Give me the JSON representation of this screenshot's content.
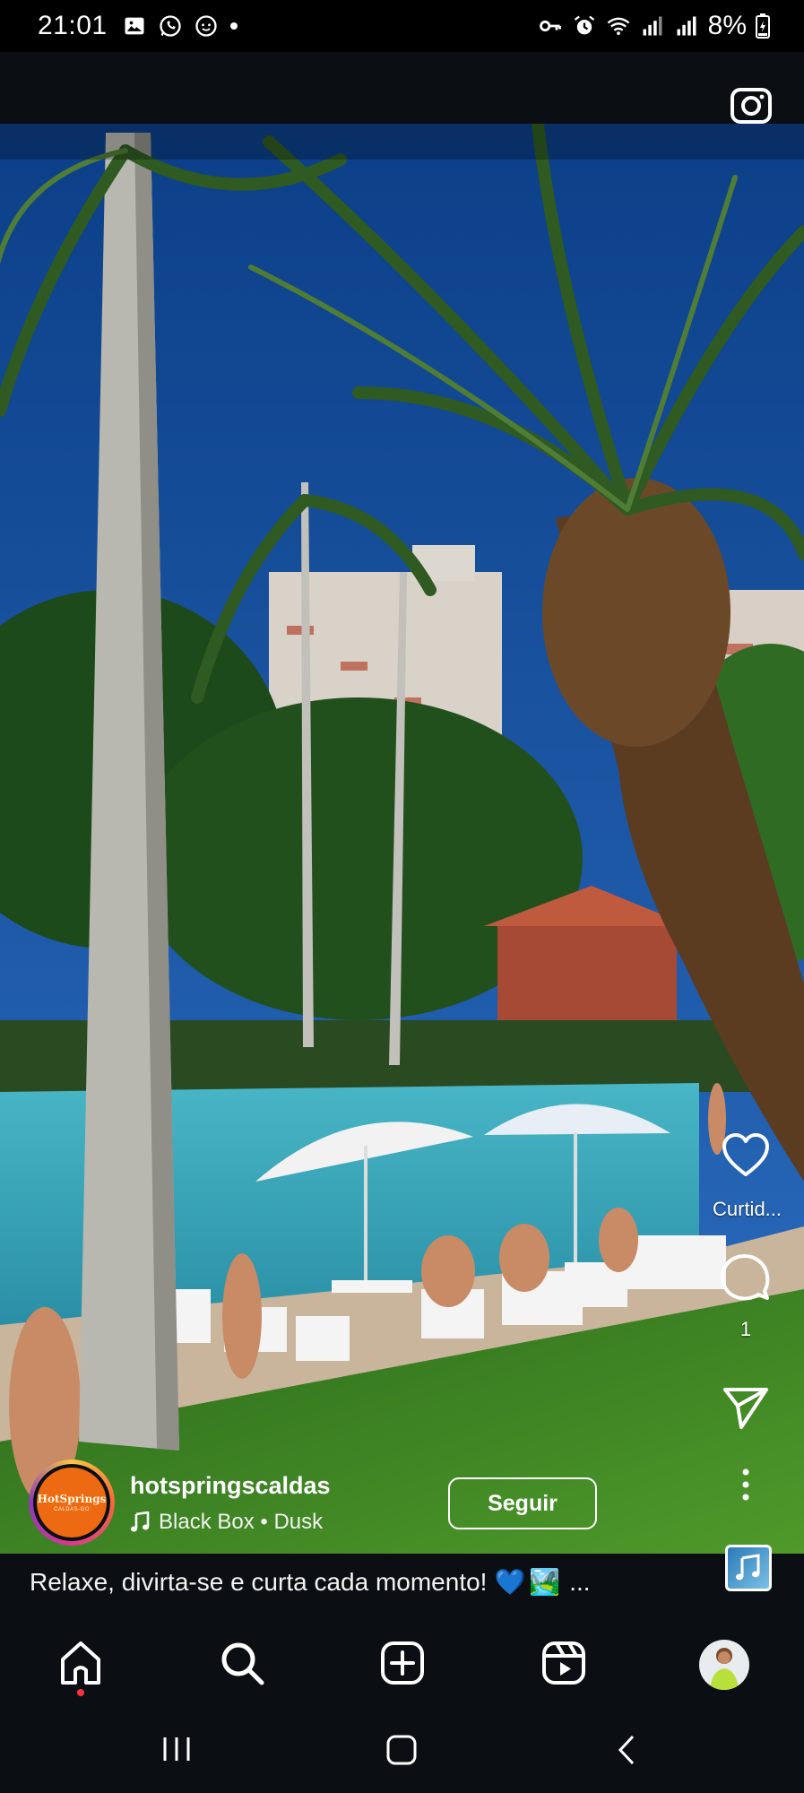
{
  "status_bar": {
    "time": "21:01",
    "battery": "8%",
    "left_icons": [
      "gallery-icon",
      "whatsapp-icon",
      "messenger-icon",
      "dot"
    ],
    "right_icons": [
      "vpn-key-icon",
      "alarm-icon",
      "wifi-icon",
      "signal-icon",
      "signal-icon",
      "battery-icon"
    ]
  },
  "header": {
    "camera_icon": "camera-icon"
  },
  "actions": {
    "like_label": "Curtid...",
    "comments_count": "1",
    "share_icon": "send-icon",
    "more_icon": "more-vertical-icon"
  },
  "author": {
    "username": "hotspringscaldas",
    "avatar_text": "HotSprings",
    "avatar_subtext": "CALDAS-GO",
    "follow_label": "Seguir",
    "audio": "Black Box • Dusk"
  },
  "caption": {
    "text": "Relaxe, divirta-se e curta cada momento!",
    "emojis": [
      "💙",
      "🏞️"
    ],
    "more": "..."
  },
  "nav": {
    "items": [
      "home-icon",
      "search-icon",
      "create-icon",
      "reels-icon",
      "profile-avatar"
    ]
  },
  "colors": {
    "background": "#0b0f14",
    "accent_red": "#ff3040",
    "avatar_orange": "#ee6a12"
  }
}
